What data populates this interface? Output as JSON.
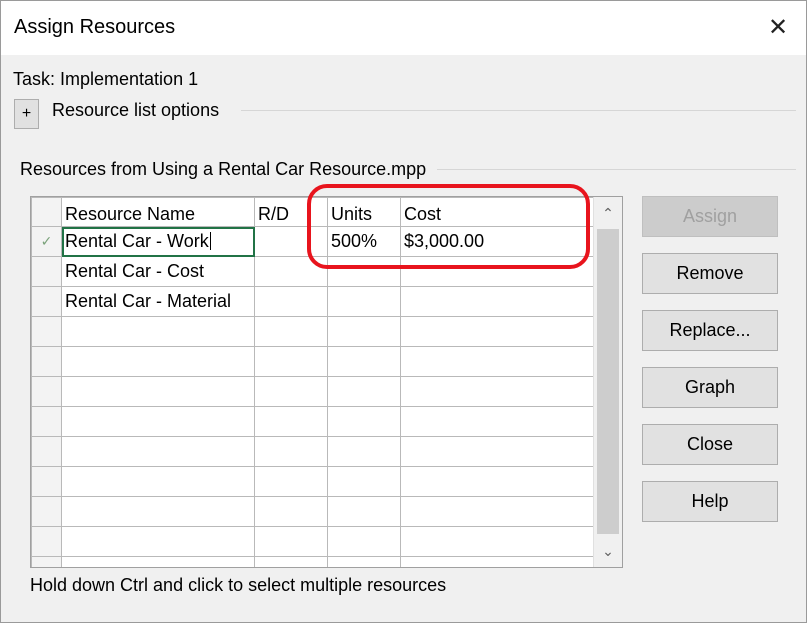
{
  "window": {
    "title": "Assign Resources",
    "close_glyph": "✕"
  },
  "task": {
    "label": "Task: Implementation 1"
  },
  "resource_list_options": {
    "expand_glyph": "+",
    "label": "Resource list options"
  },
  "group": {
    "label": "Resources from Using a Rental Car Resource.mpp"
  },
  "grid": {
    "columns": [
      "Resource Name",
      "R/D",
      "Units",
      "Cost"
    ],
    "rows": [
      {
        "assigned_mark": "✓",
        "name": "Rental Car - Work",
        "rd": "",
        "units": "500%",
        "cost": "$3,000.00"
      },
      {
        "assigned_mark": "",
        "name": "Rental Car - Cost",
        "rd": "",
        "units": "",
        "cost": ""
      },
      {
        "assigned_mark": "",
        "name": "Rental Car - Material",
        "rd": "",
        "units": "",
        "cost": ""
      },
      {
        "assigned_mark": "",
        "name": "",
        "rd": "",
        "units": "",
        "cost": ""
      },
      {
        "assigned_mark": "",
        "name": "",
        "rd": "",
        "units": "",
        "cost": ""
      },
      {
        "assigned_mark": "",
        "name": "",
        "rd": "",
        "units": "",
        "cost": ""
      },
      {
        "assigned_mark": "",
        "name": "",
        "rd": "",
        "units": "",
        "cost": ""
      },
      {
        "assigned_mark": "",
        "name": "",
        "rd": "",
        "units": "",
        "cost": ""
      },
      {
        "assigned_mark": "",
        "name": "",
        "rd": "",
        "units": "",
        "cost": ""
      },
      {
        "assigned_mark": "",
        "name": "",
        "rd": "",
        "units": "",
        "cost": ""
      },
      {
        "assigned_mark": "",
        "name": "",
        "rd": "",
        "units": "",
        "cost": ""
      },
      {
        "assigned_mark": "",
        "name": "",
        "rd": "",
        "units": "",
        "cost": ""
      }
    ],
    "scroll_up_glyph": "⌃",
    "scroll_down_glyph": "⌄"
  },
  "buttons": {
    "assign": "Assign",
    "remove": "Remove",
    "replace": "Replace...",
    "graph": "Graph",
    "close": "Close",
    "help": "Help"
  },
  "footer": {
    "hint": "Hold down Ctrl and click to select multiple resources"
  },
  "colors": {
    "highlight": "#e8141d",
    "selected_cell_border": "#217346",
    "check": "#7aa27a"
  }
}
